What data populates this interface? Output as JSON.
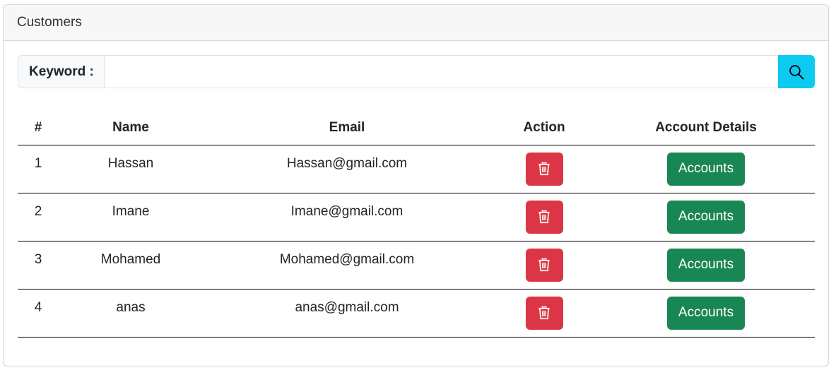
{
  "card": {
    "title": "Customers"
  },
  "search": {
    "label": "Keyword :",
    "value": "",
    "icon": "search-icon",
    "button_color": "#0dcaf0"
  },
  "table": {
    "headers": [
      "#",
      "Name",
      "Email",
      "Action",
      "Account Details"
    ],
    "rows": [
      {
        "id": "1",
        "name": "Hassan",
        "email": "Hassan@gmail.com",
        "action_icon": "trash-icon",
        "accounts_label": "Accounts"
      },
      {
        "id": "2",
        "name": "Imane",
        "email": "Imane@gmail.com",
        "action_icon": "trash-icon",
        "accounts_label": "Accounts"
      },
      {
        "id": "3",
        "name": "Mohamed",
        "email": "Mohamed@gmail.com",
        "action_icon": "trash-icon",
        "accounts_label": "Accounts"
      },
      {
        "id": "4",
        "name": "anas",
        "email": "anas@gmail.com",
        "action_icon": "trash-icon",
        "accounts_label": "Accounts"
      }
    ]
  },
  "colors": {
    "delete": "#dc3545",
    "accounts": "#198754"
  }
}
